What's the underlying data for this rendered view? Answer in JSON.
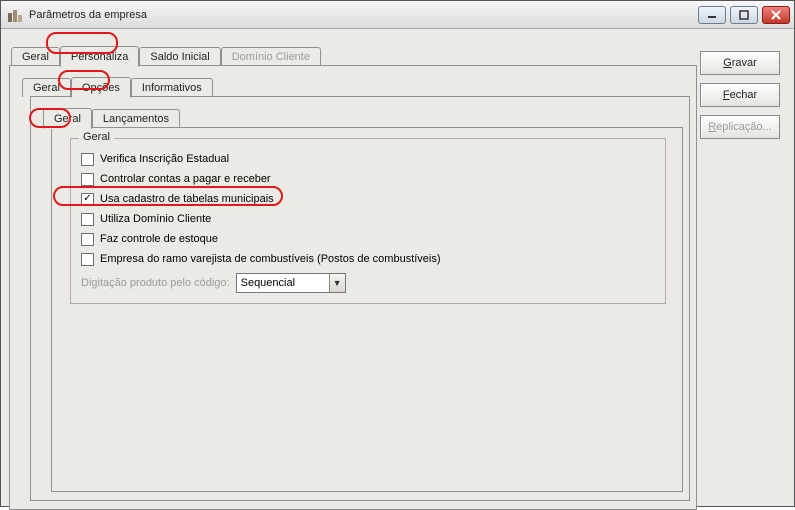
{
  "window": {
    "title": "Parâmetros da empresa"
  },
  "side": {
    "gravar_pre": "G",
    "gravar_post": "ravar",
    "fechar_pre": "F",
    "fechar_post": "echar",
    "replicacao_pre": "R",
    "replicacao_post": "eplicação..."
  },
  "tabs_outer": {
    "geral": "Geral",
    "personaliza": "Personaliza",
    "saldo_inicial": "Saldo Inicial",
    "dominio_cliente": "Domínio Cliente"
  },
  "tabs_mid": {
    "geral": "Geral",
    "opcoes": "Opções",
    "informativos": "Informativos"
  },
  "tabs_inner": {
    "geral": "Geral",
    "lancamentos": "Lançamentos"
  },
  "group": {
    "legend": "Geral",
    "chk1": "Verifica Inscrição Estadual",
    "chk2": "Controlar contas a pagar e receber",
    "chk3": "Usa cadastro de tabelas municipais",
    "chk4": "Utiliza Domínio Cliente",
    "chk5": "Faz controle de estoque",
    "chk6": "Empresa do ramo varejista de combustíveis (Postos de combustíveis)",
    "digitacao_label": "Digitação produto pelo código:",
    "digitacao_value": "Sequencial"
  }
}
